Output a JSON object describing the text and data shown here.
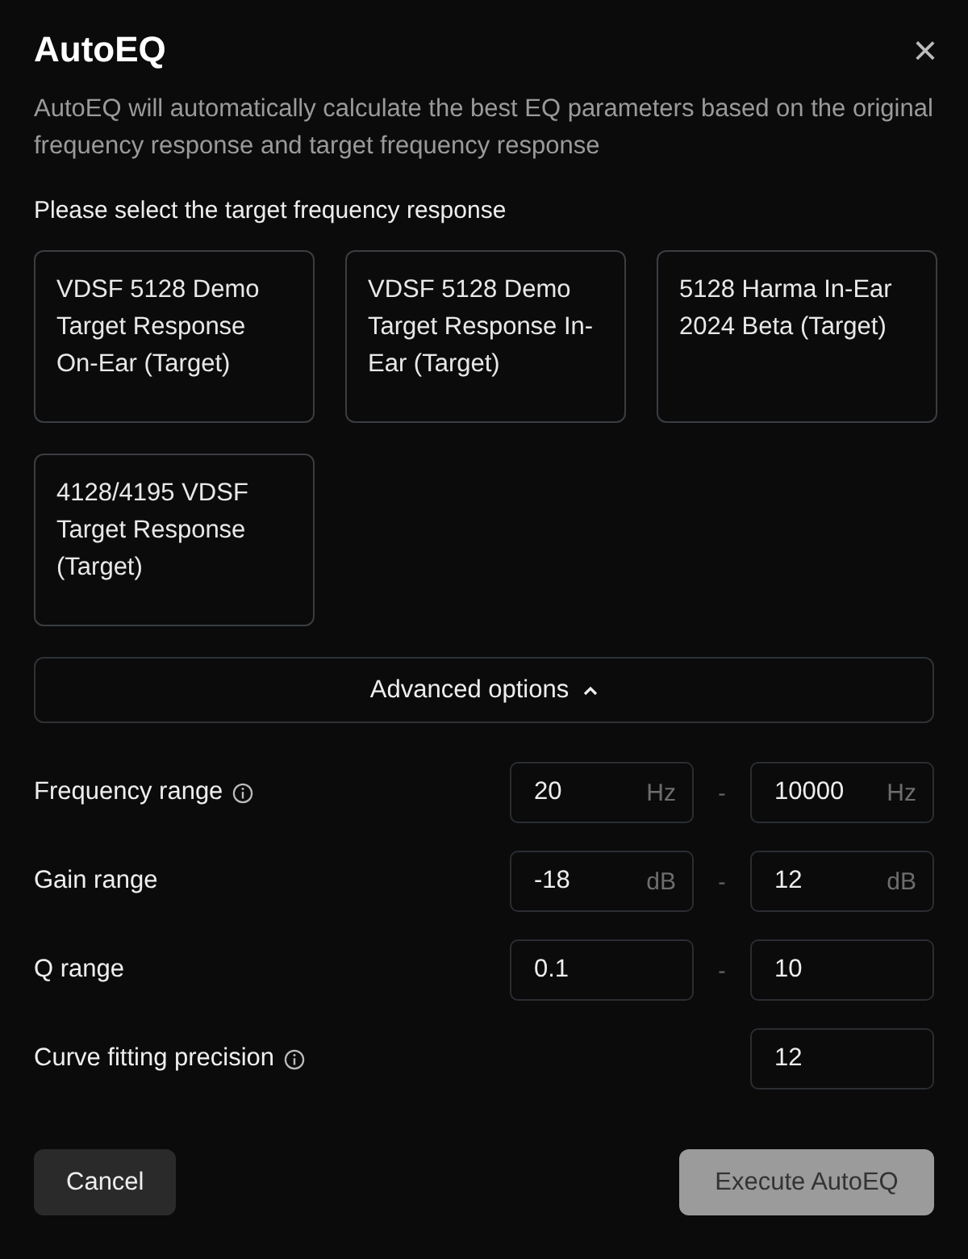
{
  "dialog": {
    "title": "AutoEQ",
    "close": "×",
    "description": "AutoEQ will automatically calculate the best EQ parameters based on the original frequency response and target frequency response"
  },
  "target_prompt": "Please select the target frequency response",
  "targets": [
    {
      "label": "VDSF 5128 Demo Target Response On-Ear (Target)",
      "selected": false
    },
    {
      "label": "VDSF 5128 Demo Target Response In-Ear (Target)",
      "selected": false
    },
    {
      "label": "5128 Harma In-Ear 2024 Beta (Target)",
      "selected": false
    },
    {
      "label": "4128/4195 VDSF Target Response (Target)",
      "selected": false
    }
  ],
  "advanced": {
    "label": "Advanced options",
    "expanded": true
  },
  "options": [
    {
      "label": "Frequency range",
      "info": true,
      "separator": "-",
      "fields": [
        {
          "value": "20",
          "unit": "Hz"
        },
        {
          "value": "10000",
          "unit": "Hz"
        }
      ]
    },
    {
      "label": "Gain range",
      "info": false,
      "separator": "-",
      "fields": [
        {
          "value": "-18",
          "unit": "dB"
        },
        {
          "value": "12",
          "unit": "dB"
        }
      ]
    },
    {
      "label": "Q range",
      "info": false,
      "separator": "-",
      "fields": [
        {
          "value": "0.1"
        },
        {
          "value": "10"
        }
      ]
    },
    {
      "label": "Curve fitting precision",
      "info": true,
      "fields": [
        {
          "value": "12"
        }
      ]
    }
  ],
  "buttons": [
    {
      "label": "Cancel",
      "kind": "secondary",
      "disabled": false
    },
    {
      "label": "Execute AutoEQ",
      "kind": "primary",
      "disabled": true
    }
  ]
}
